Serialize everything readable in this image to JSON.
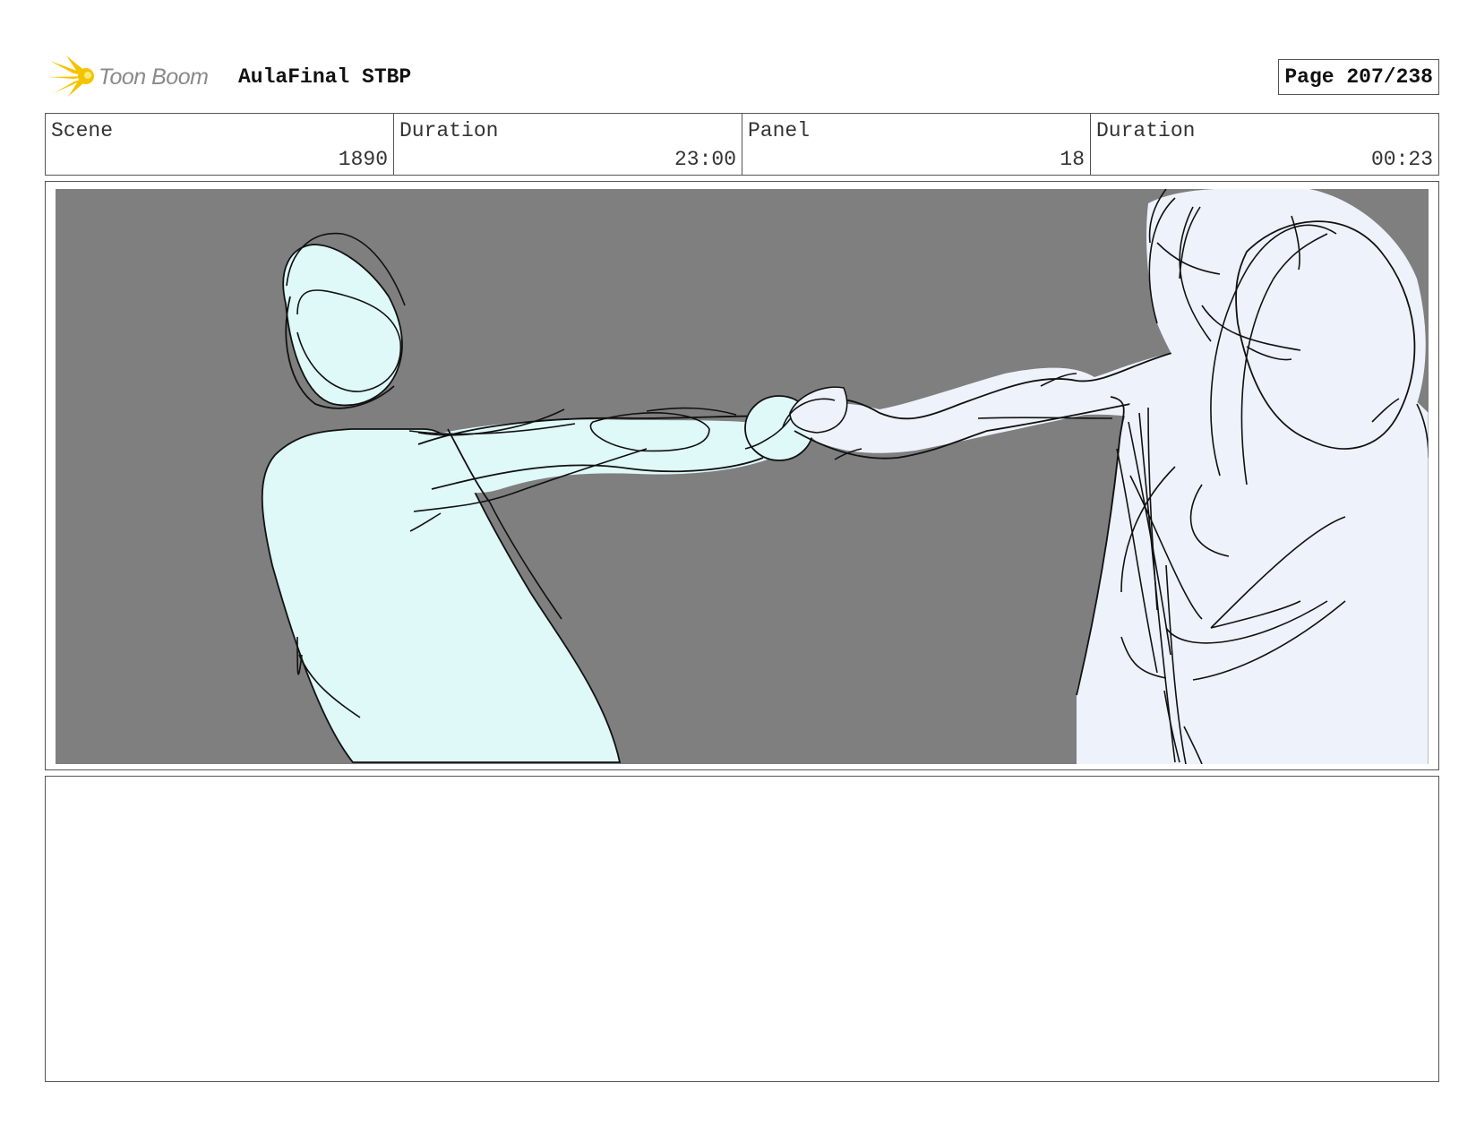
{
  "header": {
    "logo_text": "Toon Boom",
    "project_title": "AulaFinal STBP",
    "page_label": "Page 207/238"
  },
  "info": {
    "scene_label": "Scene",
    "scene_value": "1890",
    "scene_duration_label": "Duration",
    "scene_duration_value": "23:00",
    "panel_label": "Panel",
    "panel_value": "18",
    "panel_duration_label": "Duration",
    "panel_duration_value": "00:23"
  },
  "colors": {
    "background_gray": "#7f7f7f",
    "left_figure_fill": "#dff8f8",
    "right_figure_fill": "#eef2fb",
    "logo_yellow": "#f5c400"
  },
  "notes": {
    "action_text": ""
  }
}
